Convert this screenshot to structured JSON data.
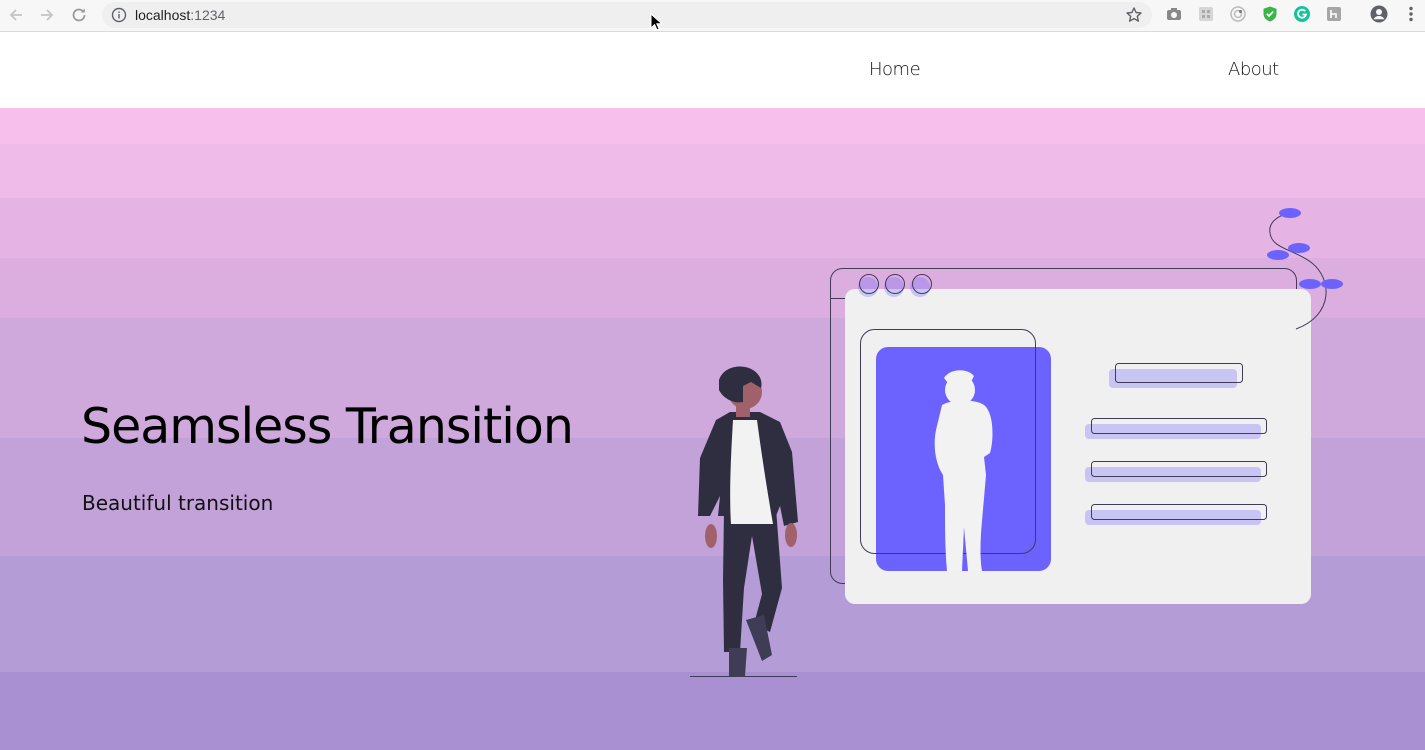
{
  "browser": {
    "url_host": "localhost",
    "url_port": ":1234"
  },
  "nav": {
    "links": [
      {
        "label": "Home"
      },
      {
        "label": "About"
      }
    ]
  },
  "hero": {
    "title": "Seamsless Transition",
    "subtitle": "Beautiful transition",
    "accent_color": "#6c63ff",
    "gradient_colors": [
      "#f7c0ec",
      "#efbbe8",
      "#e6b4e4",
      "#dcaee0",
      "#cfa8dc",
      "#c3a2d9",
      "#b49cd6",
      "#a890d2"
    ]
  }
}
